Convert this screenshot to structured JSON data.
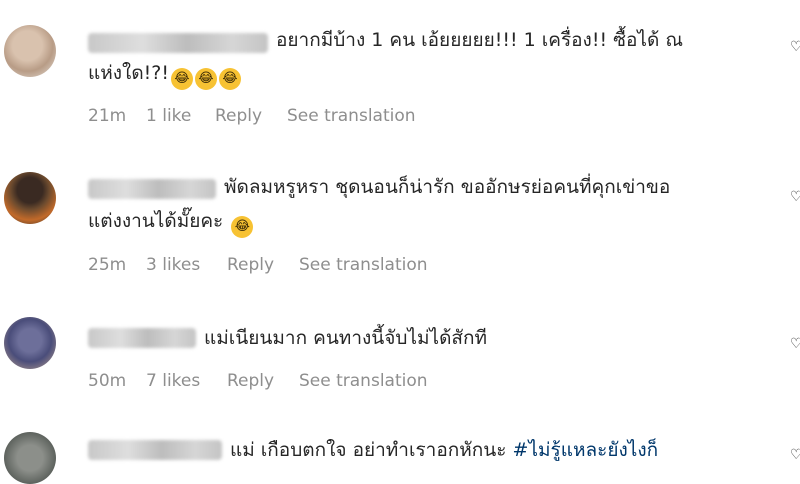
{
  "comments": [
    {
      "line1": "อยากมีบ้าง 1 คน เอ้ยยยยย!!! 1 เครื่อง!! ซื้อได้ ณ",
      "line2": "แห่งใด!?!",
      "emojis": [
        "😂",
        "😂",
        "😂"
      ],
      "time": "21m",
      "likes": "1 like",
      "reply": "Reply",
      "translate": "See translation"
    },
    {
      "line1": "พัดลมหรูหรา ชุดนอนก็น่ารัก ขออักษรย่อคนที่คุกเข่าขอ",
      "line2": "แต่งงานได้มั๊ยคะ",
      "emojis": [
        "😂"
      ],
      "time": "25m",
      "likes": "3 likes",
      "reply": "Reply",
      "translate": "See translation"
    },
    {
      "line1": "แม่เนียนมาก คนทางนี้จับไม่ได้สักที",
      "time": "50m",
      "likes": "7 likes",
      "reply": "Reply",
      "translate": "See translation"
    },
    {
      "line1": "แม่ เกือบตกใจ อย่าทำเราอกหักนะ",
      "hashtag": "#ไม่รู้แหละยังไงก็"
    }
  ]
}
